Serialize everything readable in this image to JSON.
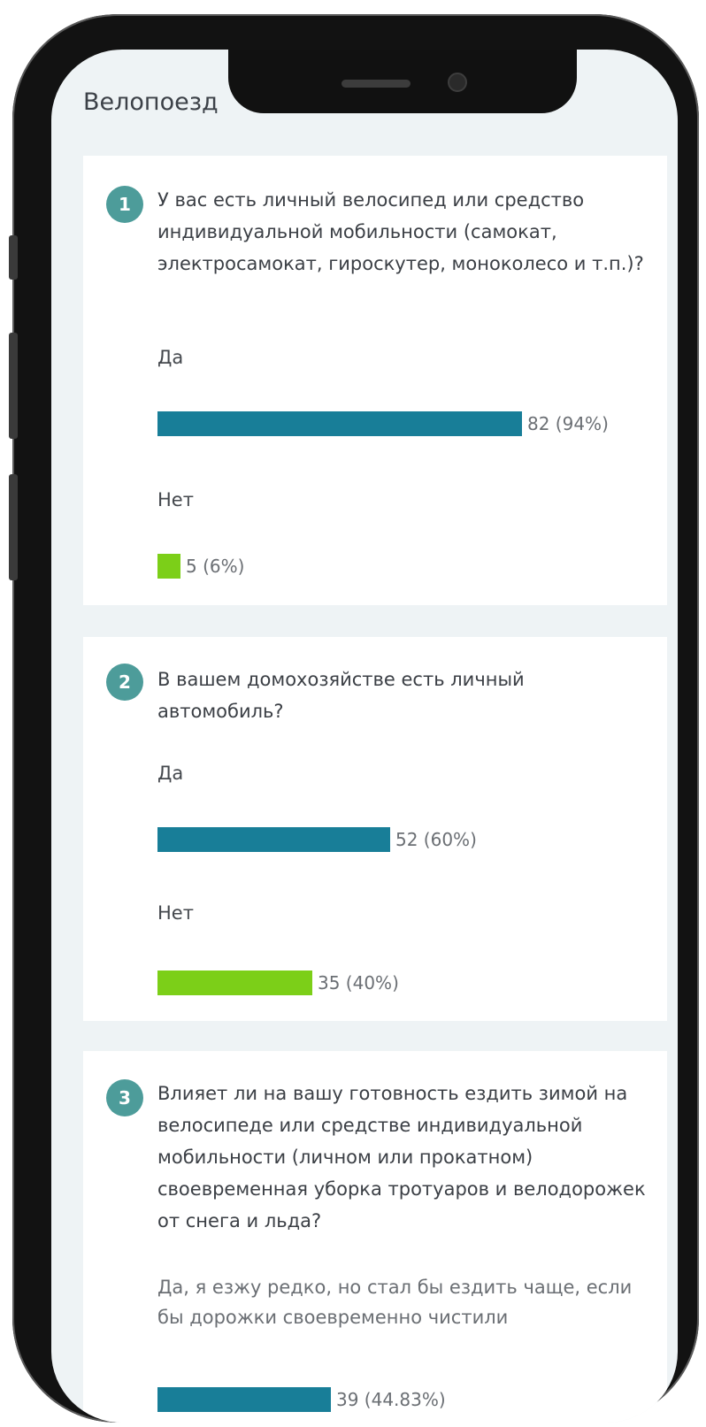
{
  "header": {
    "title": "Велопоезд"
  },
  "questions": [
    {
      "number": "1",
      "text": "У вас есть личный велосипед или средство индивидуальной мобильности (самокат, электросамокат, гироскутер, моноколесо и т.п.)?",
      "options": [
        {
          "label": "Да",
          "value": "82 (94%)",
          "fraction": 0.94,
          "color": "#187e98"
        },
        {
          "label": "Нет",
          "value": "5 (6%)",
          "fraction": 0.06,
          "color": "#7ccf18"
        }
      ]
    },
    {
      "number": "2",
      "text": "В вашем домохозяйстве есть личный автомобиль?",
      "options": [
        {
          "label": "Да",
          "value": "52 (60%)",
          "fraction": 0.6,
          "color": "#187e98"
        },
        {
          "label": "Нет",
          "value": "35 (40%)",
          "fraction": 0.4,
          "color": "#7ccf18"
        }
      ]
    },
    {
      "number": "3",
      "text": "Влияет ли на вашу готовность ездить зимой на велосипеде или средстве индивидуальной мобильности (личном или прокатном) своевременная уборка тротуаров и велодорожек от снега и льда?",
      "options": [
        {
          "label": "Да, я езжу редко, но стал бы ездить чаще, если бы дорожки своевременно чистили",
          "value": "39 (44.83%)",
          "fraction": 0.4483,
          "color": "#187e98"
        }
      ]
    }
  ]
}
